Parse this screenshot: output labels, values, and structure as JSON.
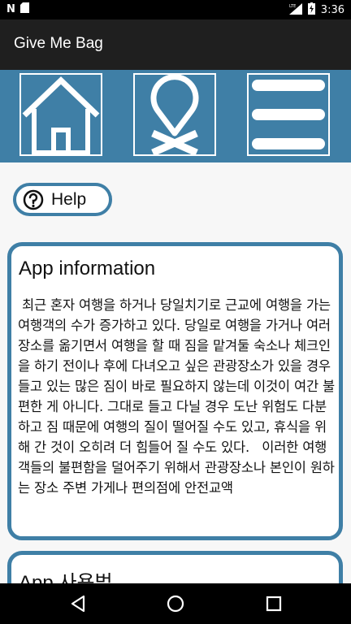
{
  "status_bar": {
    "time": "3:36",
    "icons": [
      "n-notification-icon",
      "sd-card-icon",
      "lte-signal-icon",
      "battery-charging-icon"
    ]
  },
  "app_bar": {
    "title": "Give Me Bag"
  },
  "toolbar": {
    "buttons": [
      "home-icon",
      "location-pin-icon",
      "menu-icon"
    ]
  },
  "help": {
    "label": "Help",
    "icon": "question-icon"
  },
  "cards": [
    {
      "title": "App information",
      "body": " 최근 혼자 여행을 하거나 당일치기로 근교에 여행을 가는 여행객의 수가 증가하고 있다. 당일로 여행을 가거나 여러 장소를 옮기면서 여행을 할 때 짐을 맡겨둘 숙소나 체크인을 하기 전이나 후에 다녀오고 싶은 관광장소가 있을 경우 들고 있는 많은 짐이 바로 필요하지 않는데 이것이 여간 불편한 게 아니다. 그대로 들고 다닐 경우 도난 위험도 다분하고 짐 때문에 여행의 질이 떨어질 수도 있고, 휴식을 위해 간 것이 오히려 더 힘들어 질 수도 있다.   이러한 여행객들의 불편함을 덜어주기 위해서 관광장소나 본인이 원하는 장소 주변 가게나 편의점에 안전교액"
    },
    {
      "title": "App 사용법",
      "body": ""
    }
  ],
  "colors": {
    "accent": "#3f7fa6",
    "appbar": "#1f1f1f",
    "background": "#f7f7f7"
  },
  "nav_bar": {
    "buttons": [
      "back-icon",
      "home-circle-icon",
      "recents-icon"
    ]
  }
}
